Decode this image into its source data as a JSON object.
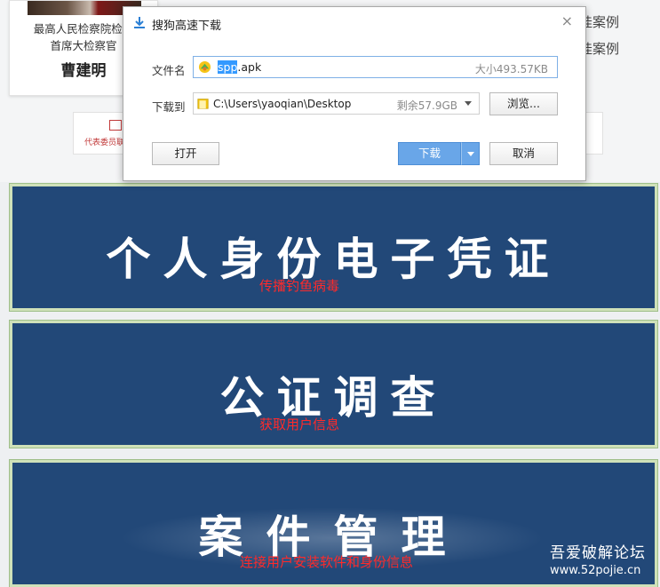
{
  "background": {
    "profile": {
      "title_line1": "最高人民检察院检察",
      "title_line2": "首席大检察官",
      "name": "曹建明"
    },
    "right_list": [
      "娃案例",
      "娃案例"
    ],
    "stamp_text": "代表委员联"
  },
  "banners": [
    {
      "title": "个人身份电子凭证",
      "annotation": "传播钓鱼病毒"
    },
    {
      "title": "公证调查",
      "annotation": "获取用户信息"
    },
    {
      "title": "案件管理",
      "annotation": "连接用户安装软件和身份信息"
    }
  ],
  "watermark": {
    "site_name": "吾爱破解论坛",
    "url": "www.52pojie.cn"
  },
  "dialog": {
    "title": "搜狗高速下载",
    "close_glyph": "×",
    "filename_label": "文件名",
    "filename_selected": "spp",
    "filename_ext": ".apk",
    "file_size": "大小493.57KB",
    "saveto_label": "下载到",
    "save_path": "C:\\Users\\yaoqian\\Desktop",
    "free_space": "剩余57.9GB",
    "browse_label": "浏览...",
    "open_label": "打开",
    "download_label": "下载",
    "cancel_label": "取消"
  },
  "colors": {
    "banner_bg": "#224878",
    "banner_border": "#cfe1b9",
    "annotation": "#ff2a2a",
    "download_button": "#69a6e8"
  }
}
